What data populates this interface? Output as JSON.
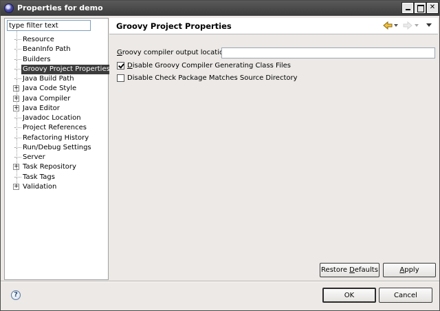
{
  "window": {
    "title": "Properties for demo"
  },
  "filter": {
    "value": "type filter text"
  },
  "tree": {
    "items": [
      {
        "label": "Resource",
        "expandable": false
      },
      {
        "label": "BeanInfo Path",
        "expandable": false
      },
      {
        "label": "Builders",
        "expandable": false
      },
      {
        "label": "Groovy Project Properties",
        "expandable": false,
        "selected": true
      },
      {
        "label": "Java Build Path",
        "expandable": false
      },
      {
        "label": "Java Code Style",
        "expandable": true
      },
      {
        "label": "Java Compiler",
        "expandable": true
      },
      {
        "label": "Java Editor",
        "expandable": true
      },
      {
        "label": "Javadoc Location",
        "expandable": false
      },
      {
        "label": "Project References",
        "expandable": false
      },
      {
        "label": "Refactoring History",
        "expandable": false
      },
      {
        "label": "Run/Debug Settings",
        "expandable": false
      },
      {
        "label": "Server",
        "expandable": false
      },
      {
        "label": "Task Repository",
        "expandable": true
      },
      {
        "label": "Task Tags",
        "expandable": false
      },
      {
        "label": "Validation",
        "expandable": true
      }
    ]
  },
  "page": {
    "title": "Groovy Project Properties",
    "output_location_label_mnemonic": "G",
    "output_location_label_rest": "roovy compiler output location",
    "output_location_value": "",
    "checkbox_disable_generating": {
      "mnemonic": "D",
      "rest": "isable Groovy Compiler Generating Class Files",
      "checked": true
    },
    "checkbox_disable_package_check": {
      "mnemonic": "",
      "label": "Disable Check Package Matches Source Directory",
      "checked": false
    }
  },
  "buttons": {
    "restore_defaults_pre": "Restore ",
    "restore_defaults_mnemonic": "D",
    "restore_defaults_post": "efaults",
    "apply_mnemonic": "A",
    "apply_rest": "pply",
    "ok": "OK",
    "cancel": "Cancel",
    "help": "?"
  }
}
